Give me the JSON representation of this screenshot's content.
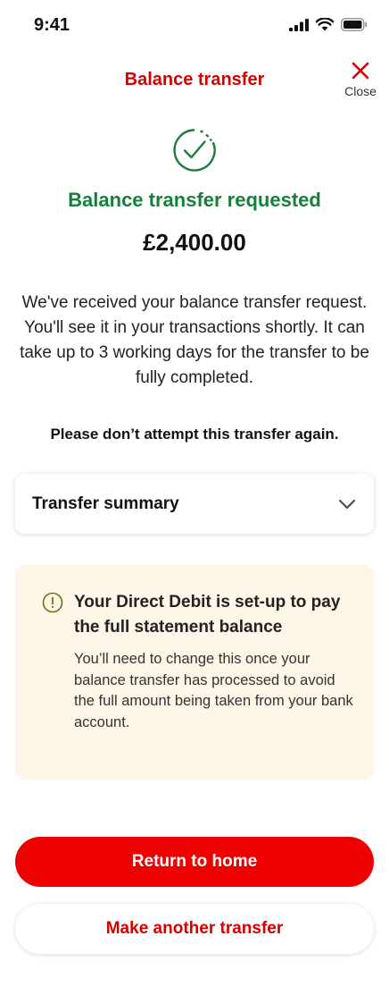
{
  "status_bar": {
    "time": "9:41",
    "icons": [
      "cellular-signal-icon",
      "wifi-icon",
      "battery-icon"
    ]
  },
  "header": {
    "title": "Balance transfer",
    "close_label": "Close",
    "close_icon": "close-icon"
  },
  "confirmation": {
    "icon": "success-check-icon",
    "title": "Balance transfer requested",
    "amount": "£2,400.00",
    "message": "We've received your balance transfer request. You'll see it in your transactions shortly.  It can take up to 3 working days for the transfer to be fully completed.",
    "warning": "Please don’t attempt this transfer again."
  },
  "summary": {
    "title": "Transfer summary",
    "icon": "chevron-down-icon"
  },
  "info_box": {
    "icon": "exclamation-circle-icon",
    "title": "Your Direct Debit is set-up to pay the full statement balance",
    "body": "You’ll need to change this once your balance transfer has processed to avoid the full amount being taken from your bank account."
  },
  "actions": {
    "primary_label": "Return to home",
    "secondary_label": "Make another transfer"
  },
  "colors": {
    "brand_red": "#ec0000",
    "header_red": "#d60000",
    "success_green": "#16803a",
    "info_background": "#fef7e8",
    "info_icon": "#7a6a1a"
  }
}
